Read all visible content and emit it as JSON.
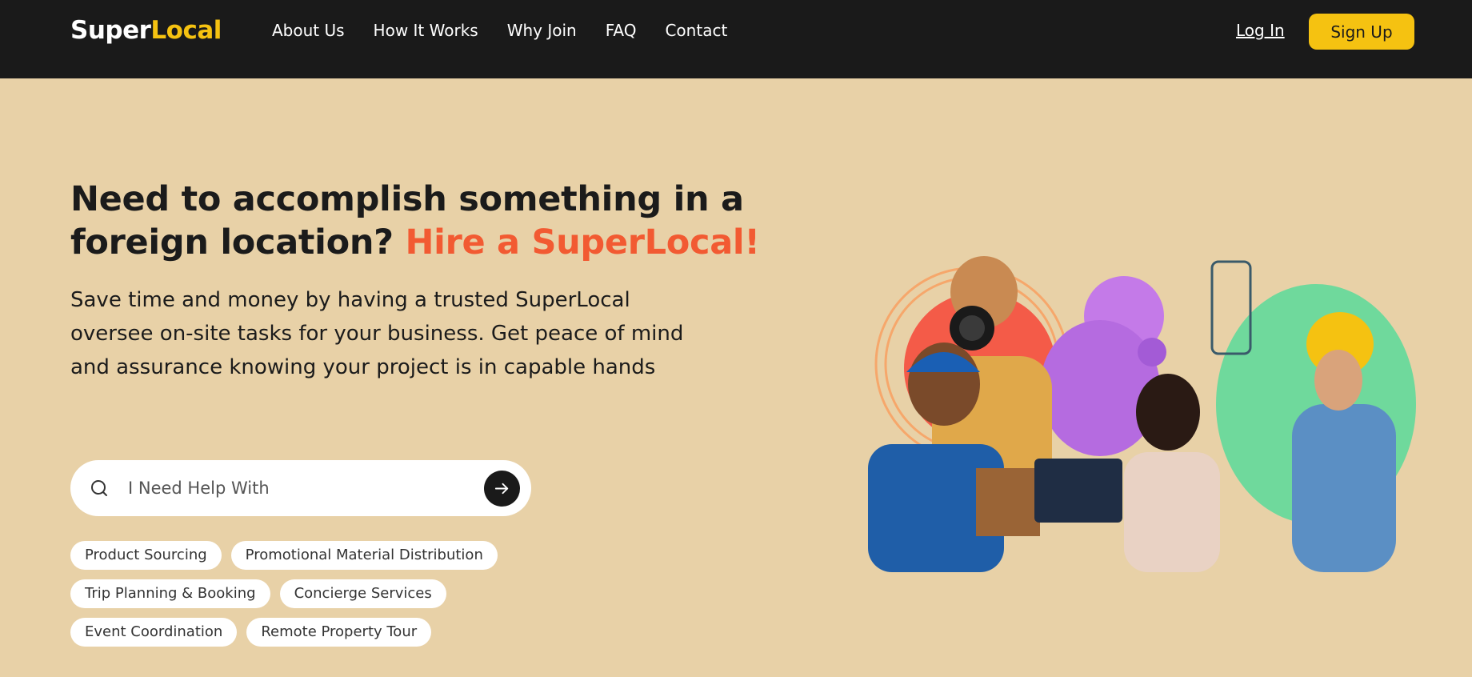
{
  "brand": {
    "part1": "Super",
    "part2": "Local"
  },
  "nav": {
    "links": [
      "About Us",
      "How It Works",
      "Why Join",
      "FAQ",
      "Contact"
    ],
    "login": "Log In",
    "signup": "Sign Up"
  },
  "hero": {
    "headline": "Need to accomplish something in a foreign location?",
    "headline_accent": "Hire a SuperLocal!",
    "subtext": "Save time and money by having a trusted SuperLocal oversee on-site tasks for your business. Get peace of mind and assurance knowing your project is in capable hands"
  },
  "search": {
    "placeholder": "I Need Help With"
  },
  "chips": [
    [
      "Product Sourcing",
      "Promotional Material Distribution"
    ],
    [
      "Trip Planning & Booking",
      "Concierge Services"
    ],
    [
      "Event Coordination",
      "Remote Property Tour"
    ]
  ],
  "colors": {
    "accent": "#f25a32",
    "brand_yellow": "#f5c211",
    "nav_bg": "#1a1a1a",
    "page_bg": "#e8d1a7"
  },
  "icons": {
    "search": "search-icon",
    "submit": "arrow-right-icon"
  }
}
